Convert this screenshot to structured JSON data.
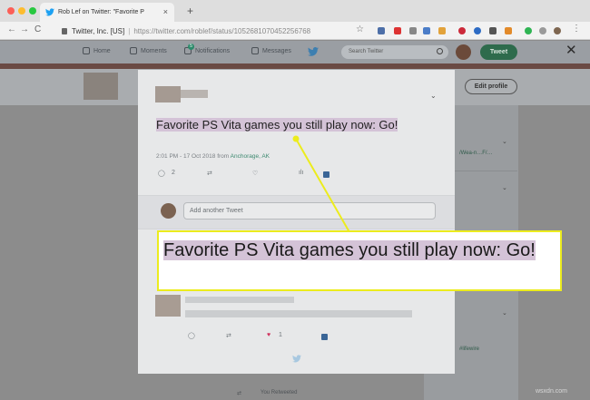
{
  "browser": {
    "tab_title": "Rob Lef on Twitter: \"Favorite P",
    "tab_close": "×",
    "new_tab": "+",
    "company": "Twitter, Inc. [US]",
    "url_path": "https://twitter.com/roblef/status/1052681070452256768",
    "back": "←",
    "forward": "→",
    "reload": "C",
    "star": "☆"
  },
  "twitter_header": {
    "home": "Home",
    "moments": "Moments",
    "notifications": "Notifications",
    "notification_count": "5",
    "messages": "Messages",
    "search_placeholder": "Search Twitter",
    "tweet_button": "Tweet",
    "overlay_close": "✕"
  },
  "profile": {
    "edit_profile": "Edit profile"
  },
  "background_column": {
    "lines": [
      "/Wea-n…F/…",
      "#lifewire"
    ]
  },
  "tweet": {
    "text": "Favorite PS Vita games you still play now: Go!",
    "timestamp": "2:01 PM - 17 Oct 2018 from ",
    "location": "Anchorage, AK",
    "reply_count": "2",
    "reply_icon": "◯",
    "retweet_icon": "⇄",
    "like_icon": "♡",
    "analytics_icon": "ılı",
    "chevron": "⌄"
  },
  "reply_box": {
    "placeholder": "Add another Tweet"
  },
  "reply_tweet": {
    "like_count": "1",
    "reply_icon": "◯",
    "retweet_icon": "⇄",
    "like_icon": "♥"
  },
  "callout": {
    "text": "Favorite PS Vita games you still play now: Go!"
  },
  "below_modal": {
    "retweeted": "You Retweeted"
  },
  "watermark": "wsxdn.com",
  "colors": {
    "highlight": "#d4c3d7",
    "callout_border": "#ecec1d",
    "twitter_blue": "#1da1f2",
    "link_green": "#3e8a70"
  }
}
